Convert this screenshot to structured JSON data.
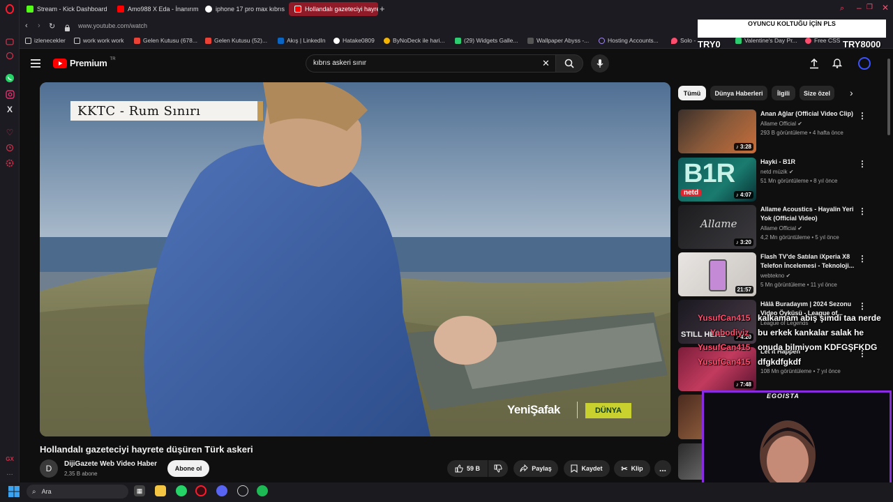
{
  "tabs": [
    {
      "label": "Stream - Kick Dashboard",
      "color": "#53fc18"
    },
    {
      "label": "Amo988 X Eda - İnanırım",
      "color": "#ff0000"
    },
    {
      "label": "iphone 17 pro max kıbrıs",
      "color": "#ffffff"
    },
    {
      "label": "Hollandalı gazeteciyi hayre",
      "color": "#ff0000"
    }
  ],
  "address": {
    "url": "www.youtube.com/watch"
  },
  "bookmarks": [
    "izlenecekler",
    "work work work",
    "Gelen Kutusu (678...",
    "Gelen Kutusu (52)...",
    "Akış | LinkedIn",
    "Hatake0809",
    "ByNoDeck ile hari...",
    "(29) Widgets Galle...",
    "Wallpaper Abyss -...",
    "Hosting Accounts...",
    "Solo -",
    "Valentine's Day Pr...",
    "Free CSS"
  ],
  "overlay": {
    "top_text": "OYUNCU KOLTUĞU İÇİN PLS",
    "left_price": "TRY0",
    "right_price": "TRY8000"
  },
  "youtube": {
    "logo": "Premium",
    "region": "TR",
    "search_value": "kıbrıs askeri sınır"
  },
  "video": {
    "caption": "KKTC - Rum Sınırı",
    "brand": "YeniŞafak",
    "brand_tag": "DÜNYA",
    "title": "Hollandalı gazeteciyi hayrete düşüren Türk askeri",
    "channel": "DijiGazete Web Video Haber",
    "channel_initial": "D",
    "subscribers": "2,35 B abone",
    "subscribe_label": "Abone ol",
    "likes": "59 B",
    "share_label": "Paylaş",
    "save_label": "Kaydet",
    "clip_label": "Klip",
    "more": "..."
  },
  "chips": [
    "Tümü",
    "Dünya Haberleri",
    "İlgili",
    "Size özel"
  ],
  "recommendations": [
    {
      "title": "Anan Ağlar (Official Video Clip)",
      "channel": "Allame Official",
      "meta": "293 B görüntüleme • 4 hafta önce",
      "duration": "3:28"
    },
    {
      "title": "Hayki - B1R",
      "channel": "netd müzik",
      "meta": "51 Mn görüntüleme • 8 yıl önce",
      "duration": "4:07",
      "thumb_text": "B1R",
      "thumb_badge": "netd"
    },
    {
      "title": "Allame Acoustics - Hayalin Yeri Yok (Official Video)",
      "channel": "Allame Official",
      "meta": "4,2 Mn görüntüleme • 5 yıl önce",
      "duration": "3:20",
      "thumb_text": "Allame"
    },
    {
      "title": "Flash TV'de Satılan iXperia X8 Telefon İncelemesi - Teknoloji...",
      "channel": "webtekno",
      "meta": "5 Mn görüntüleme • 11 yıl önce",
      "duration": "21:57"
    },
    {
      "title": "Hâlâ Buradayım | 2024 Sezonu Video Öyküsü - League of...",
      "channel": "League of Legends",
      "meta": "",
      "duration": "4:20",
      "thumb_text": "STILL HERE"
    },
    {
      "title": "Let It Happen",
      "channel": "",
      "meta": "108 Mn görüntüleme • 7 yıl önce",
      "duration": "7:48"
    }
  ],
  "chat": [
    {
      "user": "YusufCan415",
      "message": "kalkamam abiş şimdi taa nerde"
    },
    {
      "user": "Yabodiyiz",
      "message": "bu erkek kankalar salak he"
    },
    {
      "user": "YusufCan415",
      "message": "onuda bilmiyom KDFGŞFKDG"
    },
    {
      "user": "YusufCan415",
      "message": "dfgkdfgkdf"
    }
  ],
  "webcam": {
    "label": "EGOISTA"
  },
  "taskbar": {
    "search_placeholder": "Ara"
  },
  "colors": {
    "yt_red": "#ff0000",
    "accent_purple": "#8a2be2",
    "opera_red": "#ff1b2d",
    "chat_pink": "#ff4d6d"
  }
}
